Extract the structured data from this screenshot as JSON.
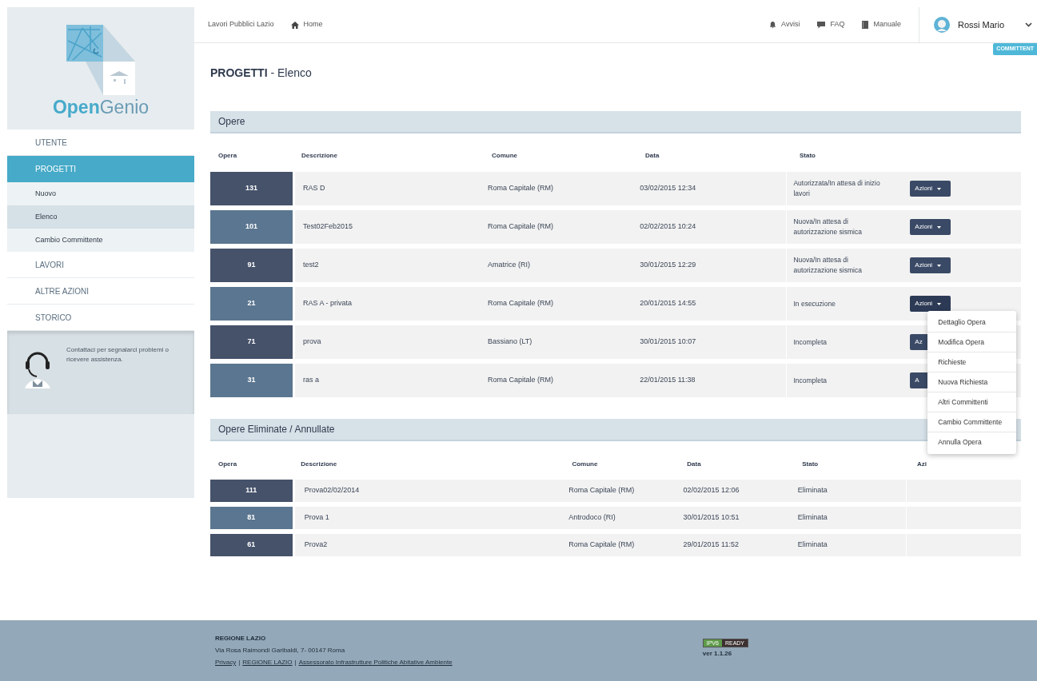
{
  "logo": {
    "part1": "Open",
    "part2": "Genio"
  },
  "sidebar": {
    "items": [
      {
        "label": "UTENTE",
        "selected": false
      },
      {
        "label": "PROGETTI",
        "selected": true,
        "children": [
          {
            "label": "Nuovo",
            "selected": false
          },
          {
            "label": "Elenco",
            "selected": true
          },
          {
            "label": "Cambio Committente",
            "selected": false
          }
        ]
      },
      {
        "label": "LAVORI",
        "selected": false
      },
      {
        "label": "ALTRE AZIONI",
        "selected": false
      },
      {
        "label": "STORICO",
        "selected": false
      }
    ],
    "help": "Contattaci per segnalarci problemi o ricevere assistenza."
  },
  "topbar": {
    "breadcrumb": [
      "Lavori Pubblici Lazio",
      "Home"
    ],
    "links": [
      {
        "kind": "bell",
        "label": "Avvisi"
      },
      {
        "kind": "chat",
        "label": "FAQ"
      },
      {
        "kind": "book",
        "label": "Manuale"
      }
    ],
    "user": "Rossi Mario",
    "role_badge": "COMMITTENT"
  },
  "page_title": {
    "strong": "PROGETTI",
    "rest": " - Elenco"
  },
  "opere": {
    "title": "Opere",
    "columns": [
      "Opera",
      "Descrizione",
      "Comune",
      "Data",
      "Stato"
    ],
    "rows": [
      {
        "opera": "131",
        "descrizione": "RAS D",
        "comune": "Roma Capitale (RM)",
        "data": "03/02/2015 12:34",
        "stato": "Autorizzata/In attesa di inizio lavori",
        "action": "Azioni",
        "menu_open": false
      },
      {
        "opera": "101",
        "descrizione": "Test02Feb2015",
        "comune": "Roma Capitale (RM)",
        "data": "02/02/2015 10:24",
        "stato": "Nuova/In attesa di autorizzazione sismica",
        "action": "Azioni",
        "menu_open": false
      },
      {
        "opera": "91",
        "descrizione": "test2",
        "comune": "Amatrice (RI)",
        "data": "30/01/2015 12:29",
        "stato": "Nuova/In attesa di autorizzazione sismica",
        "action": "Azioni",
        "menu_open": false
      },
      {
        "opera": "21",
        "descrizione": "RAS A - privata",
        "comune": "Roma Capitale (RM)",
        "data": "20/01/2015 14:55",
        "stato": "In esecuzione",
        "action": "Azioni",
        "menu_open": true
      },
      {
        "opera": "71",
        "descrizione": "prova",
        "comune": "Bassiano (LT)",
        "data": "30/01/2015 10:07",
        "stato": "Incompleta",
        "action": "Az",
        "menu_open": false
      },
      {
        "opera": "31",
        "descrizione": "ras a",
        "comune": "Roma Capitale (RM)",
        "data": "22/01/2015 11:38",
        "stato": "Incompleta",
        "action": "A",
        "menu_open": false
      }
    ]
  },
  "actions_menu": [
    "Dettaglio Opera",
    "Modifica Opera",
    "Richieste",
    "Nuova Richiesta",
    "Altri Committenti",
    "Cambio Committente",
    "Annulla Opera"
  ],
  "eliminate": {
    "title": "Opere Eliminate / Annullate",
    "columns": [
      "Opera",
      "Descrizione",
      "Comune",
      "Data",
      "Stato",
      "Azi"
    ],
    "rows": [
      {
        "opera": "111",
        "descrizione": "Prova02/02/2014",
        "comune": "Roma Capitale (RM)",
        "data": "02/02/2015 12:06",
        "stato": "Eliminata"
      },
      {
        "opera": "81",
        "descrizione": "Prova 1",
        "comune": "Antrodoco (RI)",
        "data": "30/01/2015 10:51",
        "stato": "Eliminata"
      },
      {
        "opera": "61",
        "descrizione": "Prova2",
        "comune": "Roma Capitale (RM)",
        "data": "29/01/2015 11:52",
        "stato": "Eliminata"
      }
    ]
  },
  "footer": {
    "org": "REGIONE LAZIO",
    "address": "Via Rosa Raimondi Garibaldi, 7- 00147 Roma",
    "links": [
      "Privacy",
      "REGIONE LAZIO",
      "Assessorato Infrastrutture Politiche Abitative Ambiente"
    ],
    "separator": "|",
    "badge": [
      "IPV6",
      "READY"
    ],
    "version": "ver 1.1.26"
  }
}
